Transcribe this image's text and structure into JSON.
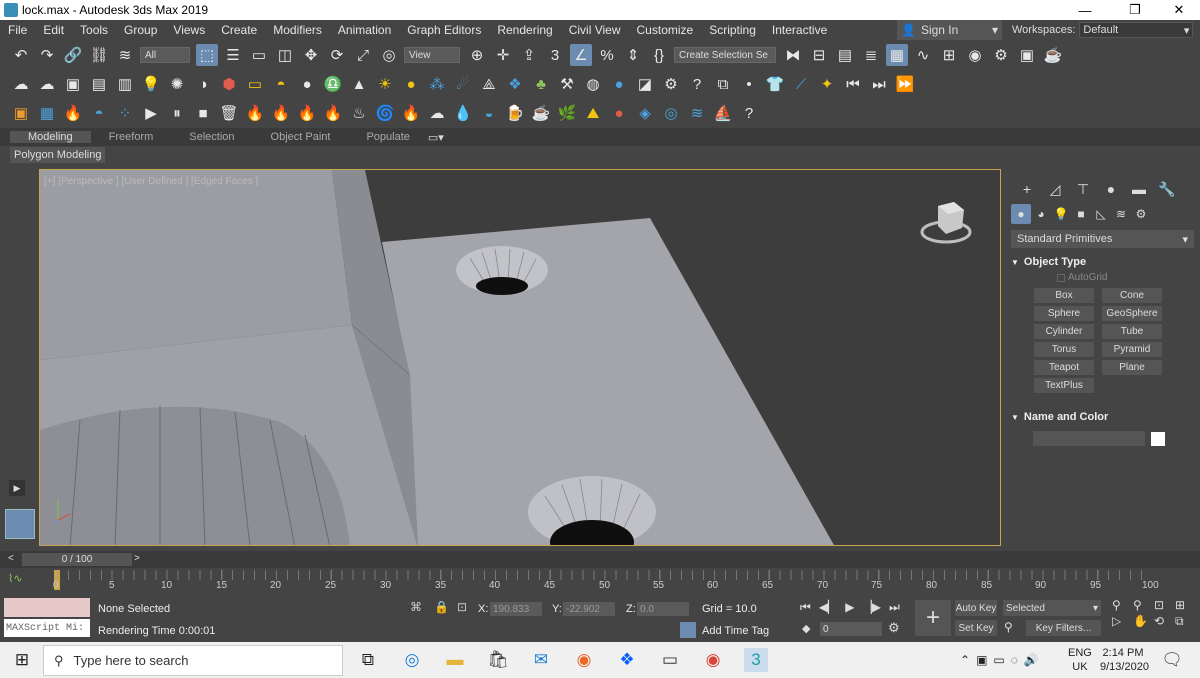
{
  "window": {
    "title": "lock.max - Autodesk 3ds Max 2019",
    "minimize": "—",
    "restore": "❐",
    "close": "✕"
  },
  "menu": [
    "File",
    "Edit",
    "Tools",
    "Group",
    "Views",
    "Create",
    "Modifiers",
    "Animation",
    "Graph Editors",
    "Rendering",
    "Civil View",
    "Customize",
    "Scripting",
    "Interactive"
  ],
  "signin": {
    "label": "Sign In"
  },
  "workspaces": {
    "label": "Workspaces:",
    "value": "Default"
  },
  "toolbar": {
    "selection_filter": "All",
    "ref_coord": "View",
    "named_selection": "Create Selection Se"
  },
  "ribbon": {
    "tabs": [
      "Modeling",
      "Freeform",
      "Selection",
      "Object Paint",
      "Populate"
    ],
    "active": "Modeling",
    "sub_label": "Polygon Modeling"
  },
  "viewport": {
    "label": "[+] [Perspective ] [User Defined ] [Edged Faces ]"
  },
  "command_panel": {
    "category": "Standard Primitives",
    "object_type": {
      "title": "Object Type",
      "autogrid": "AutoGrid",
      "buttons": [
        "Box",
        "Cone",
        "Sphere",
        "GeoSphere",
        "Cylinder",
        "Tube",
        "Torus",
        "Pyramid",
        "Teapot",
        "Plane",
        "TextPlus"
      ]
    },
    "name_color": {
      "title": "Name and Color",
      "swatch_color": "#ffffff"
    }
  },
  "timeslider": {
    "value": "0 / 100"
  },
  "trackbar": {
    "ticks": [
      "0",
      "5",
      "10",
      "15",
      "20",
      "25",
      "30",
      "35",
      "40",
      "45",
      "50",
      "55",
      "60",
      "65",
      "70",
      "75",
      "80",
      "85",
      "90",
      "95",
      "100"
    ]
  },
  "status": {
    "maxscript": "MAXScript Mi:",
    "selection": "None Selected",
    "rendering_time": "Rendering Time  0:00:01",
    "x_label": "X:",
    "x_value": "190.833",
    "y_label": "Y:",
    "y_value": "-22.902",
    "z_label": "Z:",
    "z_value": "0.0",
    "grid": "Grid = 10.0",
    "add_time_tag": "Add Time Tag",
    "auto_key": "Auto Key",
    "set_key": "Set Key",
    "selected": "Selected",
    "key_filters": "Key Filters...",
    "frame": "0"
  },
  "taskbar": {
    "search_placeholder": "Type here to search",
    "lang_top": "ENG",
    "lang_bottom": "UK",
    "time": "2:14 PM",
    "date": "9/13/2020"
  }
}
